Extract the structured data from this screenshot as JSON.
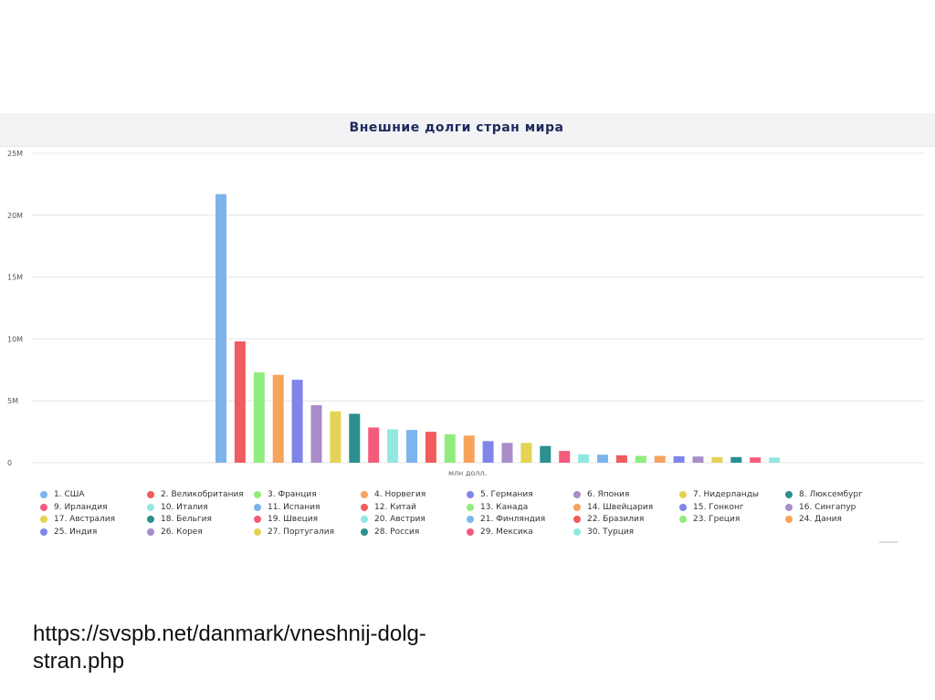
{
  "chart_data": {
    "type": "bar",
    "title": "Внешние долги стран мира",
    "xlabel": "млн долл.",
    "ylabel": "",
    "ylim": [
      0,
      25000000
    ],
    "yticks": [
      {
        "value": 0,
        "label": "0"
      },
      {
        "value": 5000000,
        "label": "5M"
      },
      {
        "value": 10000000,
        "label": "10M"
      },
      {
        "value": 15000000,
        "label": "15M"
      },
      {
        "value": 20000000,
        "label": "20M"
      },
      {
        "value": 25000000,
        "label": "25M"
      }
    ],
    "grid": true,
    "legend_position": "bottom",
    "series": [
      {
        "name": "1. США",
        "value": 21700000,
        "color": "#7cb5ec"
      },
      {
        "name": "2. Великобритания",
        "value": 9800000,
        "color": "#f15c5c"
      },
      {
        "name": "3. Франция",
        "value": 7300000,
        "color": "#90ed7d"
      },
      {
        "name": "4. Норвегия",
        "value": 7100000,
        "color": "#f7a35c"
      },
      {
        "name": "5. Германия",
        "value": 6700000,
        "color": "#8085e9"
      },
      {
        "name": "6. Япония",
        "value": 4650000,
        "color": "#a98cc8"
      },
      {
        "name": "7. Нидерланды",
        "value": 4150000,
        "color": "#e4d354"
      },
      {
        "name": "8. Люксембург",
        "value": 3950000,
        "color": "#2b908f"
      },
      {
        "name": "9. Ирландия",
        "value": 2850000,
        "color": "#f45b7a"
      },
      {
        "name": "10. Италия",
        "value": 2700000,
        "color": "#91e8e1"
      },
      {
        "name": "11. Испания",
        "value": 2650000,
        "color": "#7cb5ec"
      },
      {
        "name": "12. Китай",
        "value": 2500000,
        "color": "#f15c5c"
      },
      {
        "name": "13. Канада",
        "value": 2300000,
        "color": "#90ed7d"
      },
      {
        "name": "14. Швейцария",
        "value": 2200000,
        "color": "#f7a35c"
      },
      {
        "name": "15. Гонконг",
        "value": 1750000,
        "color": "#8085e9"
      },
      {
        "name": "16. Сингапур",
        "value": 1600000,
        "color": "#a98cc8"
      },
      {
        "name": "17. Австралия",
        "value": 1600000,
        "color": "#e4d354"
      },
      {
        "name": "18. Бельгия",
        "value": 1350000,
        "color": "#2b908f"
      },
      {
        "name": "19. Швеция",
        "value": 950000,
        "color": "#f45b7a"
      },
      {
        "name": "20. Австрия",
        "value": 680000,
        "color": "#91e8e1"
      },
      {
        "name": "21. Финляндия",
        "value": 650000,
        "color": "#7cb5ec"
      },
      {
        "name": "22. Бразилия",
        "value": 600000,
        "color": "#f15c5c"
      },
      {
        "name": "23. Греция",
        "value": 550000,
        "color": "#90ed7d"
      },
      {
        "name": "24. Дания",
        "value": 550000,
        "color": "#f7a35c"
      },
      {
        "name": "25. Индия",
        "value": 520000,
        "color": "#8085e9"
      },
      {
        "name": "26. Корея",
        "value": 500000,
        "color": "#a98cc8"
      },
      {
        "name": "27. Португалия",
        "value": 460000,
        "color": "#e4d354"
      },
      {
        "name": "28. Россия",
        "value": 460000,
        "color": "#2b908f"
      },
      {
        "name": "29. Мексика",
        "value": 430000,
        "color": "#f45b7a"
      },
      {
        "name": "30. Турция",
        "value": 420000,
        "color": "#91e8e1"
      }
    ]
  },
  "footer": {
    "source_url": "https://svspb.net/danmark/vneshnij-dolg-stran.php"
  }
}
